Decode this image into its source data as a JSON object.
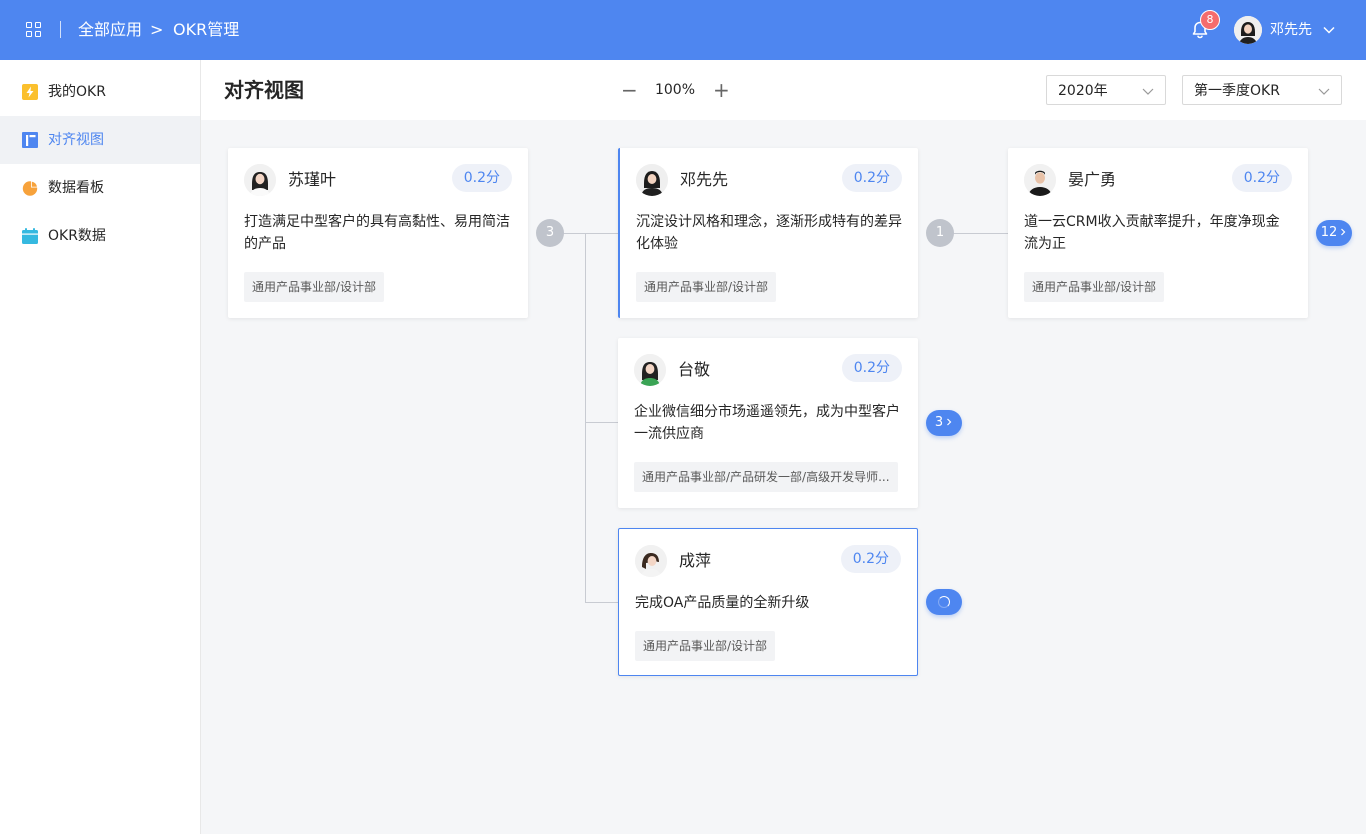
{
  "header": {
    "apps_icon": "apps-grid-icon",
    "breadcrumb": [
      "全部应用",
      "OKR管理"
    ],
    "breadcrumb_separator": ">",
    "notification_count": "8",
    "user_name": "邓先先",
    "user_menu_icon": "chevron-down-icon"
  },
  "sidebar": {
    "items": [
      {
        "label": "我的OKR",
        "icon": "lightning-icon",
        "icon_color": "#fbc02d",
        "active": false
      },
      {
        "label": "对齐视图",
        "icon": "align-view-icon",
        "icon_color": "#4e86f0",
        "active": true
      },
      {
        "label": "数据看板",
        "icon": "pie-chart-icon",
        "icon_color": "#f7a23b",
        "active": false
      },
      {
        "label": "OKR数据",
        "icon": "calendar-icon",
        "icon_color": "#36b9e0",
        "active": false
      }
    ]
  },
  "toolbar": {
    "title": "对齐视图",
    "zoom_minus": "−",
    "zoom": "100%",
    "zoom_plus": "+",
    "year": "2020年",
    "quarter": "第一季度OKR"
  },
  "cards": [
    {
      "name": "苏瑾叶",
      "score": "0.2分",
      "objective": "打造满足中型客户的具有高黏性、易用简洁的产品",
      "dept": "通用产品事业部/设计部"
    },
    {
      "name": "邓先先",
      "score": "0.2分",
      "objective": "沉淀设计风格和理念，逐渐形成特有的差异化体验",
      "dept": "通用产品事业部/设计部"
    },
    {
      "name": "晏广勇",
      "score": "0.2分",
      "objective": "道一云CRM收入贡献率提升，年度净现金流为正",
      "dept": "通用产品事业部/设计部"
    },
    {
      "name": "台敬",
      "score": "0.2分",
      "objective": "企业微信细分市场遥遥领先，成为中型客户一流供应商",
      "dept": "通用产品事业部/产品研发一部/高级开发导师..."
    },
    {
      "name": "成萍",
      "score": "0.2分",
      "objective": "完成OA产品质量的全新升级",
      "dept": "通用产品事业部/设计部"
    }
  ],
  "connectors": {
    "count_a": "3",
    "count_b": "1",
    "expand_right": "12",
    "expand_mid": "3"
  },
  "colors": {
    "primary": "#4e86f0",
    "badge": "#f56c6c",
    "score_bg": "#eef1f8"
  }
}
